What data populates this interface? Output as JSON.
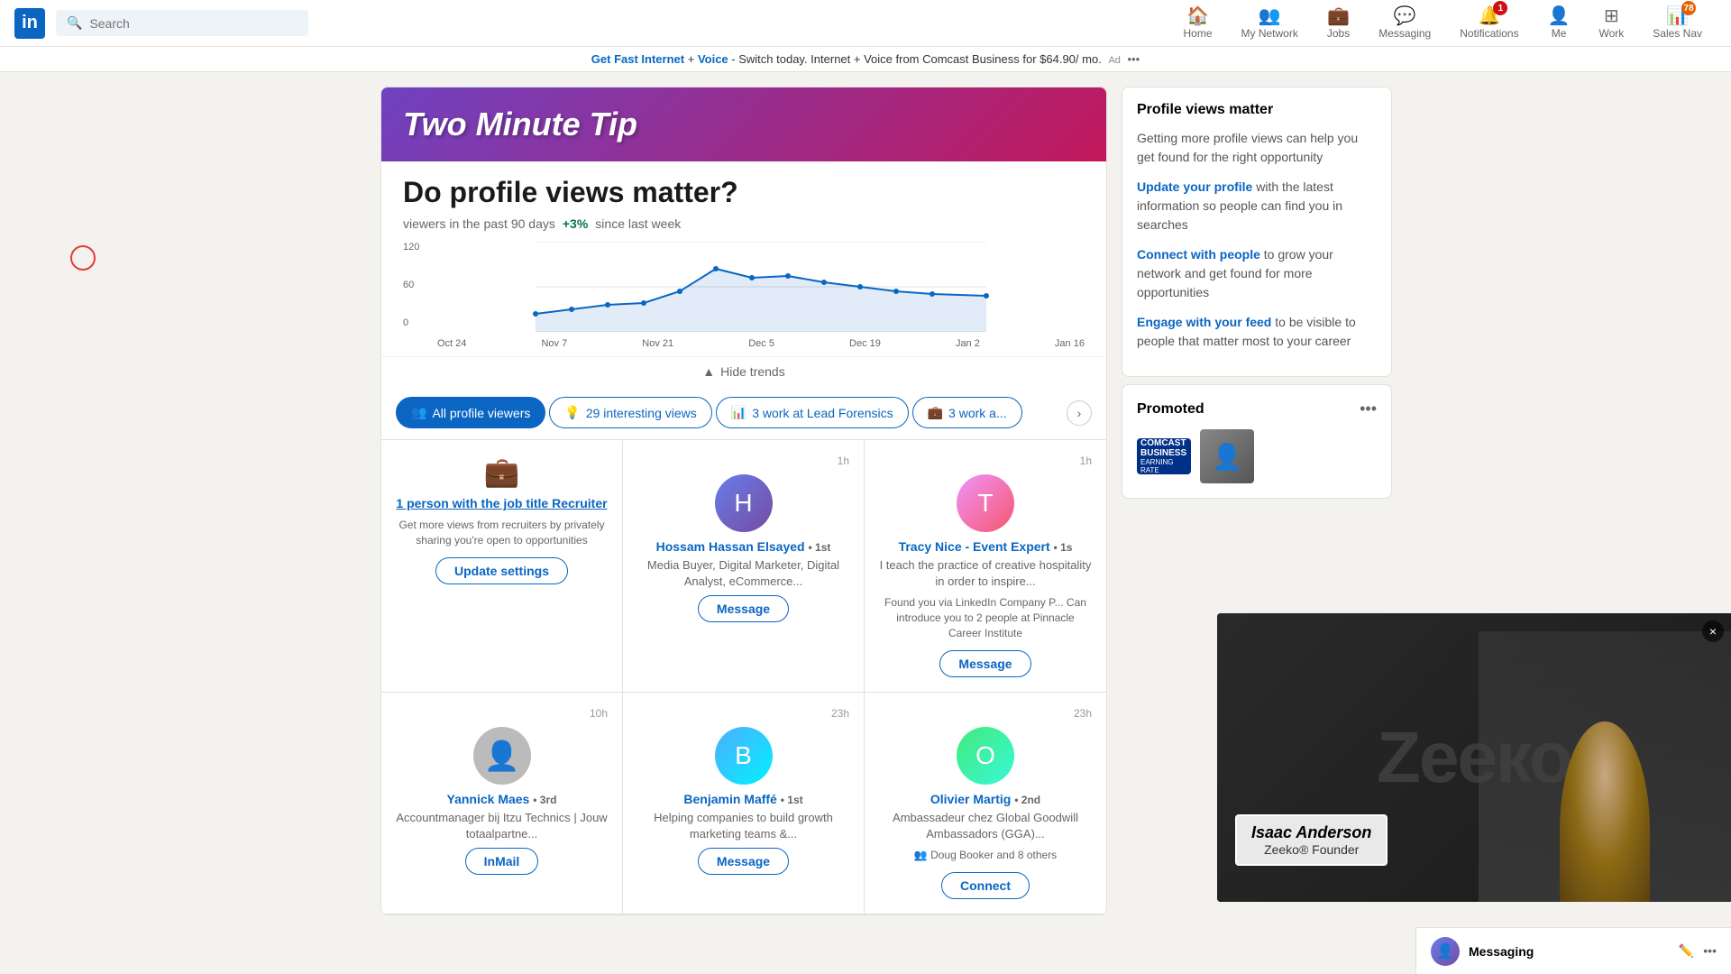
{
  "nav": {
    "logo_text": "in",
    "search_placeholder": "Search",
    "items": [
      {
        "id": "home",
        "label": "Home",
        "icon": "🏠",
        "badge": null,
        "active": false
      },
      {
        "id": "network",
        "label": "My Network",
        "icon": "👥",
        "badge": null,
        "active": false
      },
      {
        "id": "jobs",
        "label": "Jobs",
        "icon": "💼",
        "badge": null,
        "active": false
      },
      {
        "id": "messaging",
        "label": "Messaging",
        "icon": "💬",
        "badge": null,
        "active": false
      },
      {
        "id": "notifications",
        "label": "Notifications",
        "icon": "🔔",
        "badge": "1",
        "active": false
      },
      {
        "id": "me",
        "label": "Me",
        "icon": "👤",
        "badge": null,
        "active": false
      },
      {
        "id": "work",
        "label": "Work",
        "icon": "⊞",
        "badge": null,
        "active": false
      },
      {
        "id": "salesnav",
        "label": "Sales Nav",
        "icon": "📊",
        "badge": "78",
        "active": false
      }
    ]
  },
  "ad_banner": {
    "text_before": "",
    "link_text1": "Get Fast Internet",
    "separator": " + ",
    "link_text2": "Voice",
    "text_after": " - Switch today. Internet + Voice from Comcast Business for $64.90/ mo.",
    "badge": "Ad"
  },
  "banner": {
    "headline": "Two Minute Tip"
  },
  "profile_section": {
    "main_title": "Do profile views matter?",
    "viewers_text": "viewers in the past 90 days",
    "stat_text": "+3%",
    "stat_label": "since last week",
    "chart": {
      "y_labels": [
        "120",
        "60",
        "0"
      ],
      "x_labels": [
        "Oct 24",
        "Nov 7",
        "Nov 21",
        "Dec 5",
        "Dec 19",
        "Jan 2",
        "Jan 16"
      ],
      "hide_trends_label": "Hide trends"
    }
  },
  "filter_tabs": [
    {
      "id": "all",
      "label": "All profile viewers",
      "icon": "👥",
      "active": true
    },
    {
      "id": "interesting",
      "label": "29 interesting views",
      "icon": "💡",
      "active": false
    },
    {
      "id": "lead_forensics",
      "label": "3 work at Lead Forensics",
      "icon": "📊",
      "active": false
    },
    {
      "id": "work3",
      "label": "3 work a...",
      "icon": "💼",
      "active": false
    }
  ],
  "viewers": [
    {
      "type": "recruiter",
      "icon": "briefcase",
      "name": "1 person with the job title Recruiter",
      "desc": "Get more views from recruiters by privately sharing you're open to opportunities",
      "btn_label": "Update settings",
      "time": ""
    },
    {
      "type": "person",
      "name": "Hossam Hassan Elsayed",
      "connection": "1st",
      "title": "Media Buyer, Digital Marketer, Digital Analyst, eCommerce...",
      "note": "",
      "btn_label": "Message",
      "time": "1h"
    },
    {
      "type": "person",
      "name": "Tracy Nice - Event Expert",
      "connection": "1s",
      "title": "I teach the practice of creative hospitality in order to inspire...",
      "note": "Found you via LinkedIn Company P... Can introduce you to 2 people at Pinnacle Career Institute",
      "btn_label": "Message",
      "time": "1h"
    },
    {
      "type": "person",
      "name": "Yannick Maes",
      "connection": "3rd",
      "title": "Accountmanager bij Itzu Technics | Jouw totaalpartne...",
      "note": "",
      "btn_label": "InMail",
      "time": "10h"
    },
    {
      "type": "person",
      "name": "Benjamin Maffé",
      "connection": "1st",
      "title": "Helping companies to build growth marketing teams &...",
      "note": "",
      "btn_label": "Message",
      "time": "23h"
    },
    {
      "type": "person",
      "name": "Olivier Martig",
      "connection": "2nd",
      "title": "Ambassadeur chez Global Goodwill Ambassadors (GGA)...",
      "note": "Doug Booker and 8 others",
      "btn_label": "Connect",
      "time": "23h"
    }
  ],
  "right_sidebar": {
    "profile_views_matter": {
      "title": "Profile views matter",
      "desc": "Getting more profile views can help you get found for the right opportunity",
      "links": [
        {
          "text": "Update your profile",
          "rest": " with the latest information so people can find you in searches"
        },
        {
          "text": "Connect with people",
          "rest": " to grow your network and get found for more opportunities"
        },
        {
          "text": "Engage with your feed",
          "rest": " to be visible to people that matter most to your career"
        }
      ]
    },
    "promoted": {
      "title": "Promoted",
      "company": "COMCAST BUSINESS",
      "company_sub": "EARNING RATE"
    }
  },
  "video_overlay": {
    "zeeko_text": "Zeeко",
    "name": "Isaac Anderson",
    "role": "Zeeko® Founder",
    "close_btn": "×"
  },
  "messaging_bar": {
    "label": "Messaging"
  }
}
